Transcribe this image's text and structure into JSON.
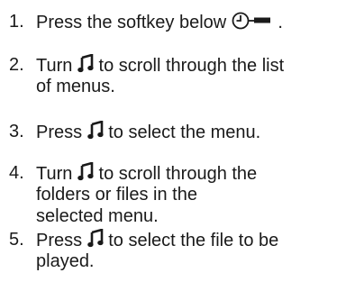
{
  "steps": [
    {
      "number": "1.",
      "lines": [
        {
          "before": "Press the softkey below",
          "icon": "clock-track-icon",
          "after": "."
        }
      ]
    },
    {
      "number": "2.",
      "lines": [
        {
          "before": "Turn",
          "icon": "music-note-knob-icon",
          "after": "to scroll through the list"
        },
        {
          "text": "of menus."
        }
      ]
    },
    {
      "number": "3.",
      "lines": [
        {
          "before": "Press",
          "icon": "music-note-knob-icon",
          "after": "to select the menu."
        }
      ]
    },
    {
      "number": "4.",
      "lines": [
        {
          "before": "Turn",
          "icon": "music-note-knob-icon",
          "after": "to scroll through the"
        },
        {
          "text": "folders or files in the"
        },
        {
          "text": "selected menu."
        }
      ]
    },
    {
      "number": "5.",
      "lines": [
        {
          "before": "Press",
          "icon": "music-note-knob-icon",
          "after": "to select the file to be"
        },
        {
          "text": "played."
        }
      ]
    }
  ]
}
